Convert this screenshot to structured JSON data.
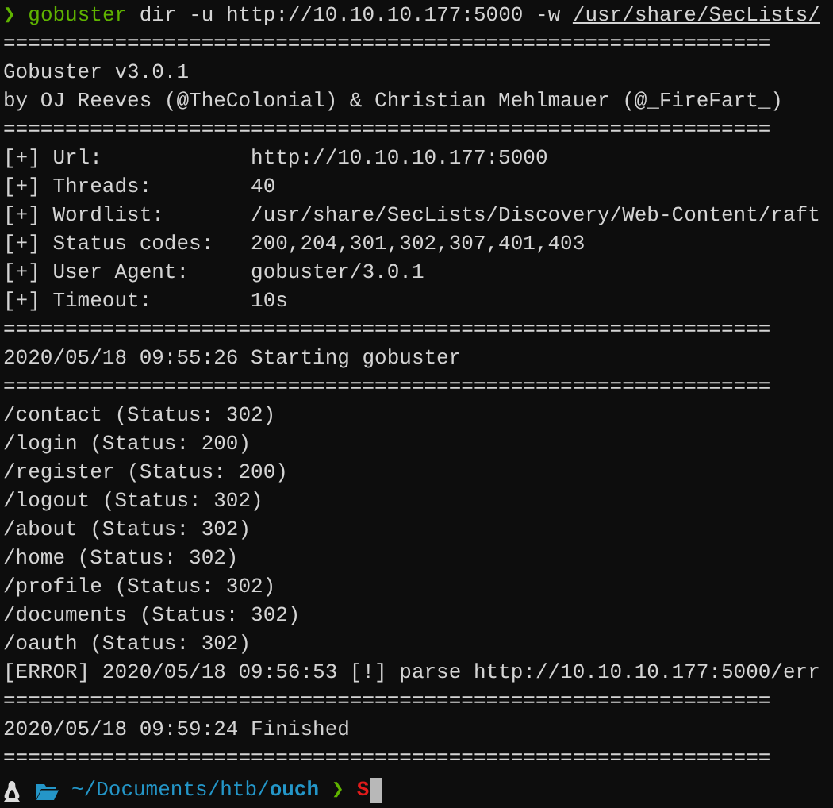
{
  "terminal": {
    "command": {
      "symbol": "❯",
      "program": "gobuster",
      "args": "dir -u http://10.10.10.177:5000 -w",
      "path": "/usr/share/SecLists/"
    },
    "lines": [
      {
        "text": "=============================================================="
      },
      {
        "text": "Gobuster v3.0.1"
      },
      {
        "text": "by OJ Reeves (@TheColonial) & Christian Mehlmauer (@_FireFart_)"
      },
      {
        "text": "=============================================================="
      },
      {
        "text": "[+] Url:            http://10.10.10.177:5000"
      },
      {
        "text": "[+] Threads:        40"
      },
      {
        "text": "[+] Wordlist:       /usr/share/SecLists/Discovery/Web-Content/raft"
      },
      {
        "text": "[+] Status codes:   200,204,301,302,307,401,403"
      },
      {
        "text": "[+] User Agent:     gobuster/3.0.1"
      },
      {
        "text": "[+] Timeout:        10s"
      },
      {
        "text": "=============================================================="
      },
      {
        "text": "2020/05/18 09:55:26 Starting gobuster"
      },
      {
        "text": "=============================================================="
      },
      {
        "text": "/contact (Status: 302)"
      },
      {
        "text": "/login (Status: 200)"
      },
      {
        "text": "/register (Status: 200)"
      },
      {
        "text": "/logout (Status: 302)"
      },
      {
        "text": "/about (Status: 302)"
      },
      {
        "text": "/home (Status: 302)"
      },
      {
        "text": "/profile (Status: 302)"
      },
      {
        "text": "/documents (Status: 302)"
      },
      {
        "text": "/oauth (Status: 302)"
      },
      {
        "text": "[ERROR] 2020/05/18 09:56:53 [!] parse http://10.10.10.177:5000/err"
      },
      {
        "text": "=============================================================="
      },
      {
        "text": "2020/05/18 09:59:24 Finished"
      },
      {
        "text": "=============================================================="
      }
    ],
    "prompt": {
      "path": "~/Documents/htb/",
      "dir": "ouch",
      "symbol": "❯",
      "input": "S"
    }
  }
}
